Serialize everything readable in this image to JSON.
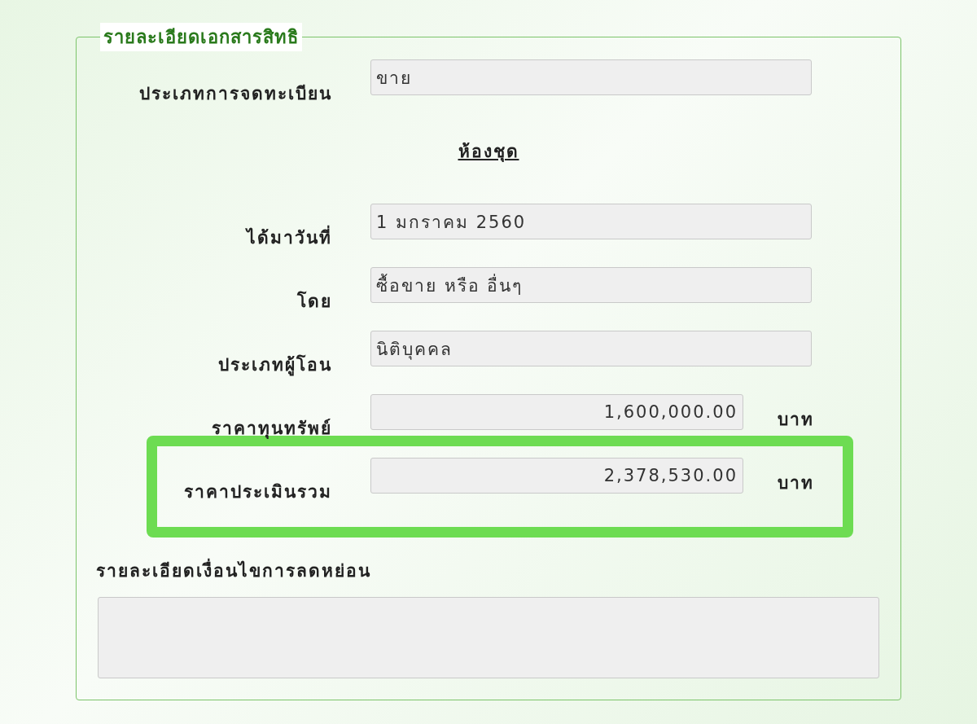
{
  "panel": {
    "title": "รายละเอียดเอกสารสิทธิ"
  },
  "registration": {
    "label": "ประเภทการจดทะเบียน",
    "value": "ขาย"
  },
  "section_heading": "ห้องชุด",
  "fields": [
    {
      "kind": "text",
      "label": "ได้มาวันที่",
      "value": "1 มกราคม 2560",
      "highlighted": false
    },
    {
      "kind": "text",
      "label": "โดย",
      "value": "ซื้อขาย หรือ อื่นๆ",
      "highlighted": false
    },
    {
      "kind": "text",
      "label": "ประเภทผู้โอน",
      "value": "นิติบุคคล",
      "highlighted": false
    },
    {
      "kind": "price",
      "label": "ราคาทุนทรัพย์",
      "value": "1,600,000.00",
      "unit": "บาท",
      "highlighted": false
    },
    {
      "kind": "price",
      "label": "ราคาประเมินรวม",
      "value": "2,378,530.00",
      "unit": "บาท",
      "highlighted": true
    }
  ],
  "conditions": {
    "label": "รายละเอียดเงื่อนไขการลดหย่อน"
  }
}
